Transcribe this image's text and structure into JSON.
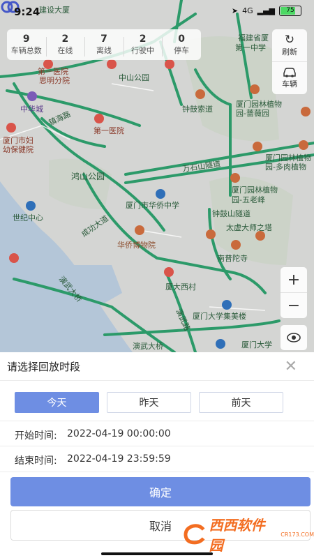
{
  "status_bar": {
    "time": "9:24",
    "network": "4G",
    "battery": "75"
  },
  "stats": [
    {
      "value": "9",
      "label": "车辆总数"
    },
    {
      "value": "2",
      "label": "在线"
    },
    {
      "value": "7",
      "label": "离线"
    },
    {
      "value": "2",
      "label": "行驶中"
    },
    {
      "value": "0",
      "label": "停车"
    }
  ],
  "side_controls": {
    "refresh_label": "刷新",
    "vehicle_label": "车辆"
  },
  "zoom": {
    "in": "+",
    "out": "−"
  },
  "map_labels": {
    "top_building": "建设大厦",
    "fujian_province": "福建省厦",
    "no1_middle": "第一中学",
    "zhongshan_park": "中山公园",
    "hospital1": "第一医院",
    "siming_branch": "思明分院",
    "zhonghua_city": "中华城",
    "zhenhai_road": "镇海路",
    "first_hospital": "第一医院",
    "women_child": "厦门市妇",
    "health_care": "幼保健院",
    "zhonggu_lane": "钟鼓索道",
    "garden1": "厦门园林植物",
    "garden1b": "园-蔷薇园",
    "wanshi_tunnel": "万石山隧道",
    "garden2": "厦门园林植物",
    "garden2b": "园-多肉植物",
    "hongshan_park": "鸿山公园",
    "garden3": "厦门园林植物",
    "garden3b": "园-五老峰",
    "century_center": "世纪中心",
    "overseas_school": "厦门市华侨中学",
    "chenggong_road": "成功大道",
    "zhonggu_tunnel": "钟鼓山隧道",
    "taixu_tower": "太虚大师之塔",
    "overseas_museum": "华侨博物院",
    "nanputuo": "南普陀寺",
    "yanwu_bridge": "演武大桥",
    "xiamen_xicun": "厦大西村",
    "yanwu_road": "演武路",
    "univ_building": "厦门大学集美楼",
    "yanwu_bridge2": "演武大桥",
    "xiamen_univ": "厦门大学"
  },
  "sheet": {
    "title": "请选择回放时段",
    "tabs": [
      {
        "label": "今天",
        "active": true
      },
      {
        "label": "昨天",
        "active": false
      },
      {
        "label": "前天",
        "active": false
      }
    ],
    "start_label": "开始时间:",
    "start_value": "2022-04-19 00:00:00",
    "end_label": "结束时间:",
    "end_value": "2022-04-19 23:59:59",
    "confirm": "确定",
    "cancel": "取消"
  },
  "watermark": {
    "brand": "西西软件园",
    "url": "CR173.COM"
  },
  "colors": {
    "accent": "#6e8ee3",
    "road_green": "#2c9a69",
    "marker": "#4558c8"
  }
}
